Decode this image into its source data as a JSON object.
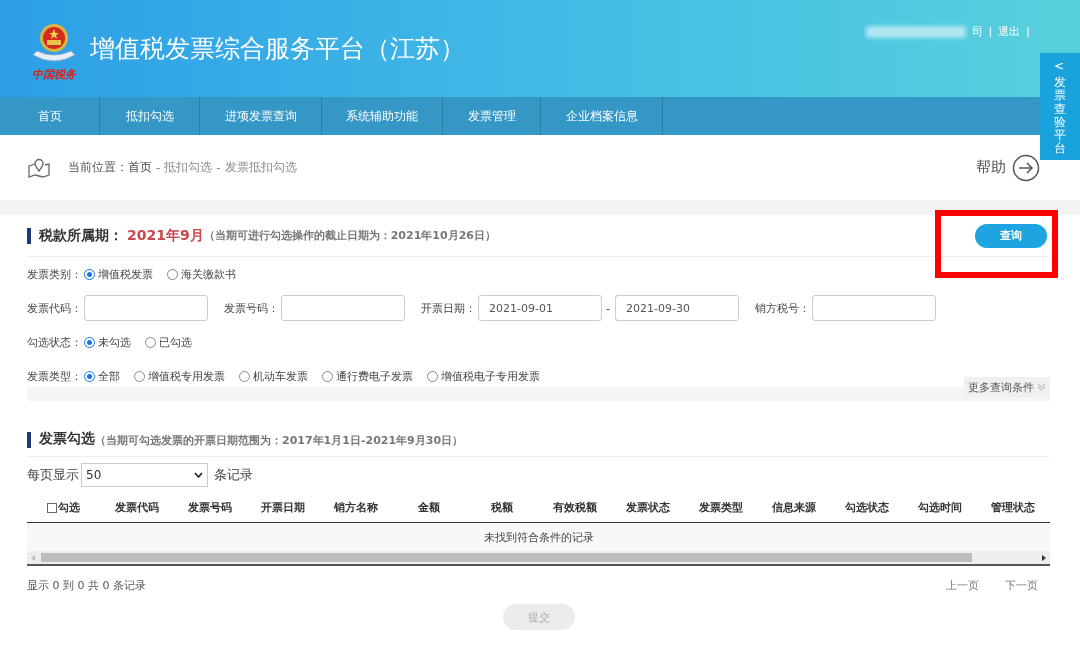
{
  "header": {
    "logo_caption": "中国税务",
    "title": "增值税发票综合服务平台（江苏）",
    "user_suffix": "司",
    "separators": [
      "|",
      "|"
    ],
    "logout": "退出"
  },
  "nav": [
    {
      "label": "首页"
    },
    {
      "label": "抵扣勾选"
    },
    {
      "label": "进项发票查询"
    },
    {
      "label": "系统辅助功能"
    },
    {
      "label": "发票管理"
    },
    {
      "label": "企业档案信息"
    }
  ],
  "side_tab": {
    "arrow": "<",
    "label": "发票查验平台"
  },
  "breadcrumb": {
    "prefix": "当前位置：",
    "crumbs": [
      {
        "kind": "link",
        "text": "首页"
      },
      {
        "kind": "sep",
        "text": "-"
      },
      {
        "kind": "link",
        "text": "抵扣勾选"
      },
      {
        "kind": "sep",
        "text": "-"
      },
      {
        "kind": "link",
        "text": "发票抵扣勾选"
      }
    ]
  },
  "help": "帮助",
  "period": {
    "label": "税款所属期：",
    "value": "2021年9月",
    "note": "（当期可进行勾选操作的截止日期为：2021年10月26日）"
  },
  "query_button": "查询",
  "filters": [
    {
      "kind": "radio",
      "label": "发票类别：",
      "options": [
        {
          "label": "增值税发票",
          "selected": true
        },
        {
          "label": "海关缴款书",
          "selected": false
        }
      ]
    },
    {
      "kind": "fields",
      "fields": [
        {
          "label": "发票代码："
        },
        {
          "label": "发票号码："
        },
        {
          "label": "开票日期：",
          "value": "2021-09-01",
          "range_separator": "-",
          "value_end": "2021-09-30"
        },
        {
          "label": "销方税号："
        }
      ]
    },
    {
      "kind": "radio",
      "label": "勾选状态：",
      "options": [
        {
          "label": "未勾选",
          "selected": true
        },
        {
          "label": "已勾选",
          "selected": false
        }
      ]
    },
    {
      "kind": "radio",
      "label": "发票类型：",
      "options": [
        {
          "label": "全部",
          "selected": true
        },
        {
          "label": "增值税专用发票",
          "selected": false
        },
        {
          "label": "机动车发票",
          "selected": false
        },
        {
          "label": "通行费电子发票",
          "selected": false
        },
        {
          "label": "增值税电子专用发票",
          "selected": false
        }
      ]
    }
  ],
  "more_conditions": "更多查询条件",
  "selection": {
    "title": "发票勾选",
    "note": "（当期可勾选发票的开票日期范围为：2017年1月1日-2021年9月30日）"
  },
  "page_size": {
    "prefix": "每页显示",
    "value": "50",
    "suffix": "条记录"
  },
  "table": {
    "select_all": {
      "label": "勾选",
      "checked": false
    },
    "columns": [
      "发票代码",
      "发票号码",
      "开票日期",
      "销方名称",
      "金额",
      "税额",
      "有效税额",
      "发票状态",
      "发票类型",
      "信息来源",
      "勾选状态",
      "勾选时间",
      "管理状态"
    ],
    "empty_message": "未找到符合条件的记录"
  },
  "footer": {
    "summary": "显示 0 到 0 共 0 条记录",
    "prev": "上一页",
    "next": "下一页"
  },
  "submit": {
    "label": "提交",
    "disabled": true
  }
}
